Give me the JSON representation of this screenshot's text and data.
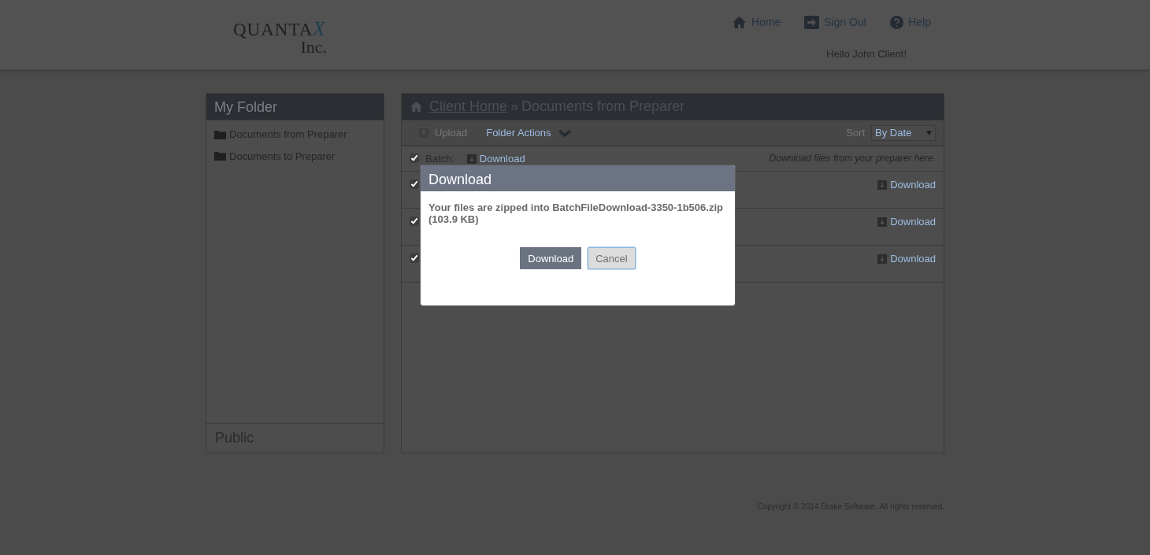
{
  "logo": {
    "name": "QUANTA",
    "mark": "X",
    "sub": "Inc."
  },
  "top_nav": [
    {
      "kind": "home",
      "label": "Home"
    },
    {
      "kind": "signout",
      "label": "Sign Out"
    },
    {
      "kind": "help",
      "label": "Help"
    }
  ],
  "greeting": "Hello John Client!",
  "sidebar": {
    "title": "My Folder",
    "items": [
      {
        "label": "Documents from Preparer"
      },
      {
        "label": "Documents to Preparer"
      }
    ],
    "footer": "Public"
  },
  "breadcrumb": {
    "home": "Client Home",
    "separator": "»",
    "current": "Documents from Preparer"
  },
  "toolbar": {
    "upload": {
      "label": "Upload",
      "disabled": true
    },
    "folder_actions": "Folder Actions",
    "sort_label": "Sort",
    "sort_value": "By Date"
  },
  "batch": {
    "checked": true,
    "label": "Batch:",
    "action": "Download",
    "hint": "Download files from your preparer here."
  },
  "files": [
    {
      "checked": true,
      "action": "Download"
    },
    {
      "checked": true,
      "action": "Download"
    },
    {
      "checked": true,
      "action": "Download"
    }
  ],
  "dialog": {
    "title": "Download",
    "message": "Your files are zipped into BatchFileDownload-3350-1b506.zip (103.9 KB)",
    "buttons": [
      {
        "kind": "primary",
        "label": "Download"
      },
      {
        "kind": "secondary",
        "label": "Cancel"
      }
    ]
  },
  "footer": "Copyright © 2014 Drake Software. All rights reserved."
}
